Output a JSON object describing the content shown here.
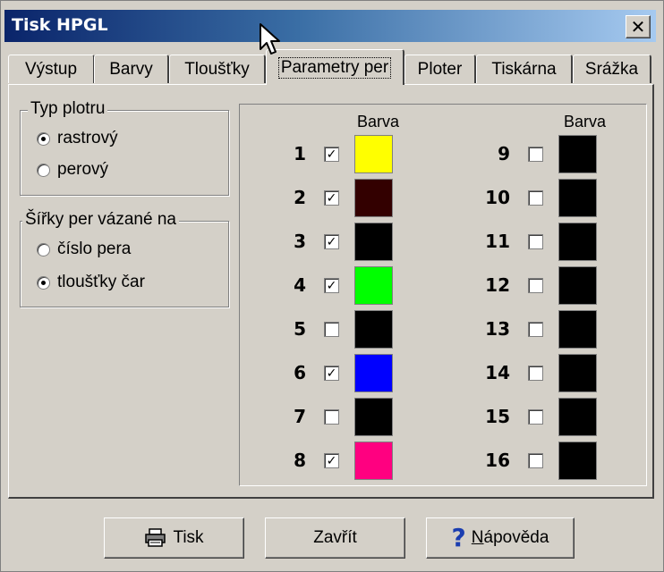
{
  "window": {
    "title": "Tisk HPGL",
    "close_symbol": "✕"
  },
  "tabs": [
    {
      "label": "Výstup",
      "active": false
    },
    {
      "label": "Barvy",
      "active": false
    },
    {
      "label": "Tloušťky",
      "active": false
    },
    {
      "label": "Parametry per",
      "active": true
    },
    {
      "label": "Ploter",
      "active": false
    },
    {
      "label": "Tiskárna",
      "active": false
    },
    {
      "label": "Srážka",
      "active": false
    }
  ],
  "plot_type": {
    "legend": "Typ plotru",
    "options": [
      {
        "label": "rastrový",
        "checked": true
      },
      {
        "label": "perový",
        "checked": false
      }
    ]
  },
  "pen_widths": {
    "legend": "Šířky per vázané na",
    "options": [
      {
        "label": "číslo pera",
        "checked": false
      },
      {
        "label": "tloušťky čar",
        "checked": true
      }
    ]
  },
  "pens": {
    "column_header": "Barva",
    "left": [
      {
        "num": "1",
        "checked": true,
        "color": "#ffff00"
      },
      {
        "num": "2",
        "checked": true,
        "color": "#330000"
      },
      {
        "num": "3",
        "checked": true,
        "color": "#000000"
      },
      {
        "num": "4",
        "checked": true,
        "color": "#00ff00"
      },
      {
        "num": "5",
        "checked": false,
        "color": "#000000"
      },
      {
        "num": "6",
        "checked": true,
        "color": "#0000ff"
      },
      {
        "num": "7",
        "checked": false,
        "color": "#000000"
      },
      {
        "num": "8",
        "checked": true,
        "color": "#ff0080"
      }
    ],
    "right": [
      {
        "num": "9",
        "checked": false,
        "color": "#000000"
      },
      {
        "num": "10",
        "checked": false,
        "color": "#000000"
      },
      {
        "num": "11",
        "checked": false,
        "color": "#000000"
      },
      {
        "num": "12",
        "checked": false,
        "color": "#000000"
      },
      {
        "num": "13",
        "checked": false,
        "color": "#000000"
      },
      {
        "num": "14",
        "checked": false,
        "color": "#000000"
      },
      {
        "num": "15",
        "checked": false,
        "color": "#000000"
      },
      {
        "num": "16",
        "checked": false,
        "color": "#000000"
      }
    ]
  },
  "buttons": {
    "print_label": "Tisk",
    "print_icon": "printer-icon",
    "close_label": "Zavřít",
    "help_label": "Nápověda",
    "help_icon": "question-mark-icon",
    "help_icon_glyph": "?"
  }
}
